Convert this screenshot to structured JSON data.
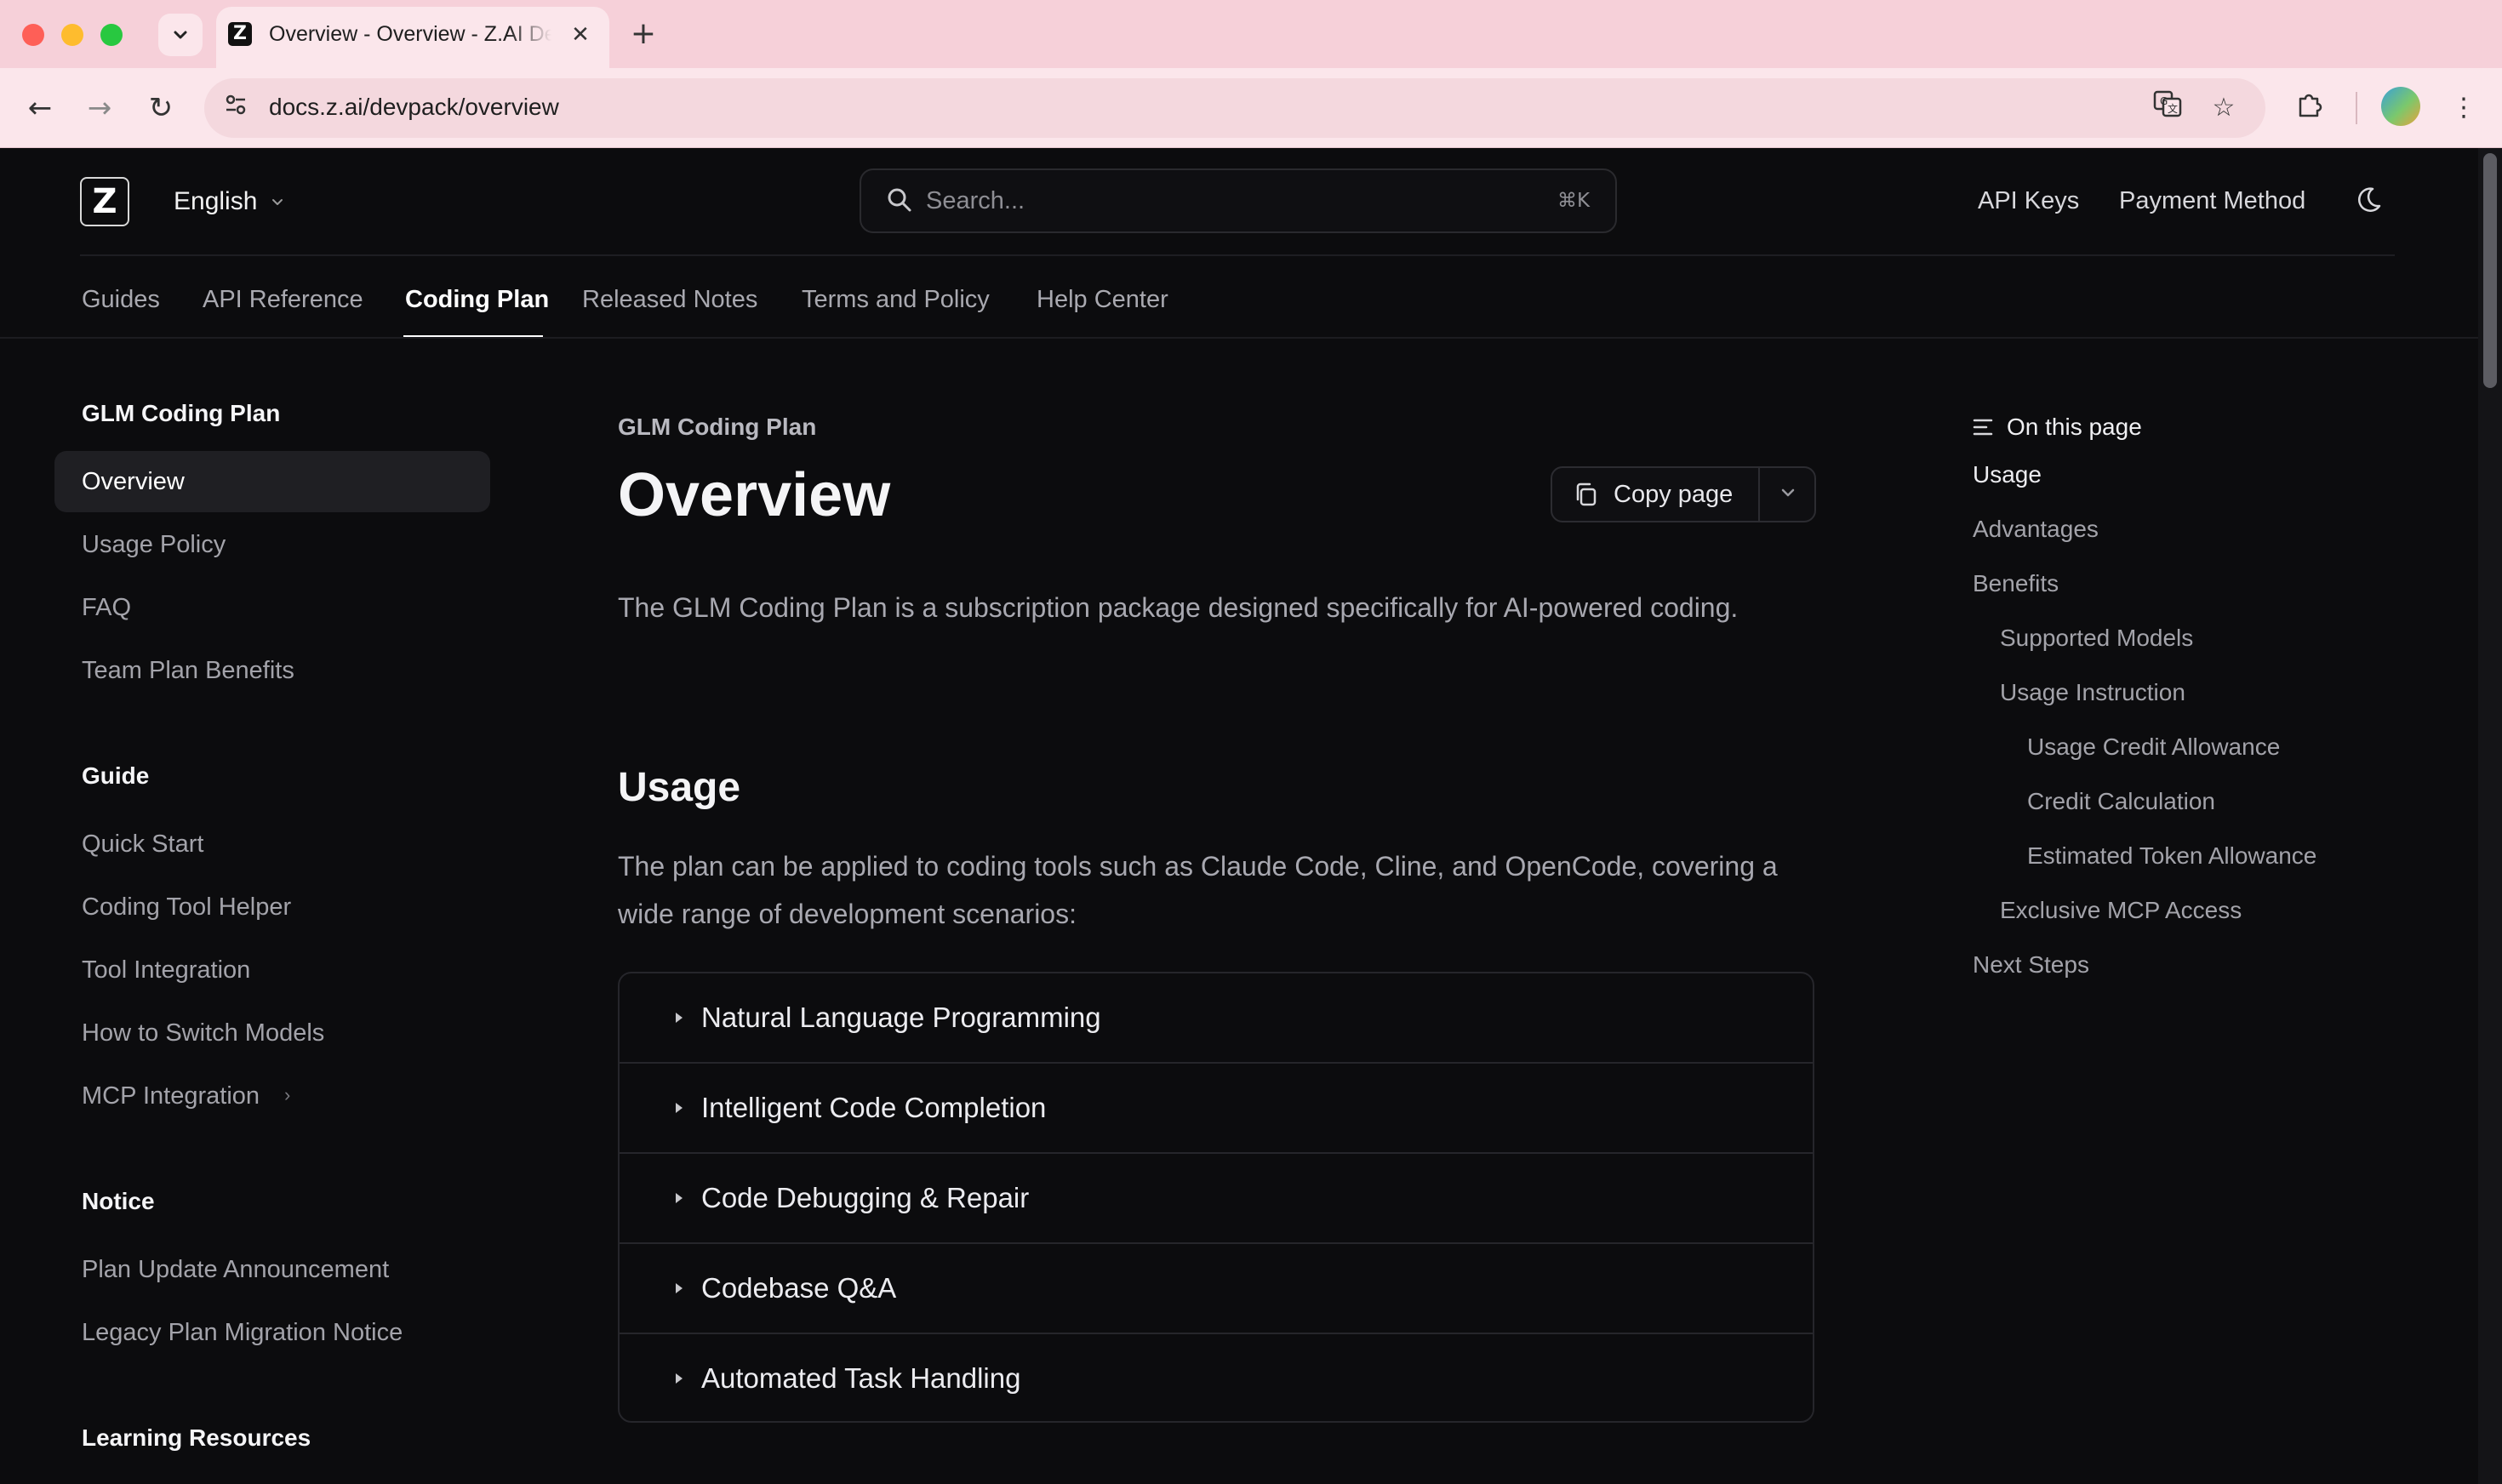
{
  "browser": {
    "tab_title": "Overview - Overview - Z.AI Developer Document",
    "tab_favicon": "Z",
    "url": "docs.z.ai/devpack/overview",
    "icons": [
      "tab-search-chevron",
      "close-icon",
      "plus-icon",
      "back-arrow-icon",
      "forward-arrow-icon",
      "reload-icon",
      "site-info-icon",
      "translate-icon",
      "star-icon",
      "extensions-icon",
      "profile-avatar",
      "more-menu-icon"
    ]
  },
  "header": {
    "logo_letter": "Z",
    "language": "English",
    "search_placeholder": "Search...",
    "search_shortcut": "⌘K",
    "links": {
      "api_keys": "API Keys",
      "payment_method": "Payment Method"
    }
  },
  "nav_tabs": [
    {
      "label": "Guides",
      "active": false
    },
    {
      "label": "API Reference",
      "active": false
    },
    {
      "label": "Coding Plan",
      "active": true
    },
    {
      "label": "Released Notes",
      "active": false
    },
    {
      "label": "Terms and Policy",
      "active": false
    },
    {
      "label": "Help Center",
      "active": false
    }
  ],
  "sidebar": {
    "groups": [
      {
        "heading": "GLM Coding Plan",
        "items": [
          "Overview",
          "Usage Policy",
          "FAQ",
          "Team Plan Benefits"
        ]
      },
      {
        "heading": "Guide",
        "items": [
          "Quick Start",
          "Coding Tool Helper",
          "Tool Integration",
          "How to Switch Models",
          "MCP Integration"
        ]
      },
      {
        "heading": "Notice",
        "items": [
          "Plan Update Announcement",
          "Legacy Plan Migration Notice"
        ]
      },
      {
        "heading": "Learning Resources",
        "items": []
      }
    ],
    "active_item": "Overview"
  },
  "main": {
    "eyebrow": "GLM Coding Plan",
    "title": "Overview",
    "copy_button": "Copy page",
    "intro": "The GLM Coding Plan is a subscription package designed specifically for AI-powered coding.",
    "usage_heading": "Usage",
    "usage_text": "The plan can be applied to coding tools such as Claude Code, Cline, and OpenCode, covering a wide range of development scenarios:",
    "accordion": [
      "Natural Language Programming",
      "Intelligent Code Completion",
      "Code Debugging & Repair",
      "Codebase Q&A",
      "Automated Task Handling"
    ]
  },
  "toc": {
    "title": "On this page",
    "items": [
      {
        "label": "Usage",
        "level": 1
      },
      {
        "label": "Advantages",
        "level": 1
      },
      {
        "label": "Benefits",
        "level": 1
      },
      {
        "label": "Supported Models",
        "level": 2
      },
      {
        "label": "Usage Instruction",
        "level": 2
      },
      {
        "label": "Usage Credit Allowance",
        "level": 3
      },
      {
        "label": "Credit Calculation",
        "level": 3
      },
      {
        "label": "Estimated Token Allowance",
        "level": 3
      },
      {
        "label": "Exclusive MCP Access",
        "level": 2
      },
      {
        "label": "Next Steps",
        "level": 1
      }
    ]
  },
  "colors": {
    "page_bg": "#0c0c0e",
    "tabbar_bg": "#f6d0d9",
    "toolbar_bg": "#fbe6eb",
    "accent_text": "#ffffff",
    "muted_text": "#a3a3aa"
  }
}
